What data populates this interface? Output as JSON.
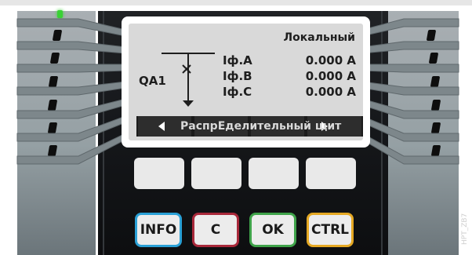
{
  "device": {
    "display": {
      "mode_label": "Локальный",
      "feeder_label": "QA1",
      "measurements": [
        {
          "name": "Iф.A",
          "value": "0.000 A"
        },
        {
          "name": "Iф.B",
          "value": "0.000 A"
        },
        {
          "name": "Iф.C",
          "value": "0.000 A"
        }
      ],
      "nav_title": "РаспрЕделительный щит"
    },
    "function_keys": [
      {
        "label": "INFO",
        "color": "#2aa0d6"
      },
      {
        "label": "C",
        "color": "#a8283a"
      },
      {
        "label": "OK",
        "color": "#3fa34a"
      },
      {
        "label": "CTRL",
        "color": "#e5a823"
      }
    ],
    "side_label": "HPT_ZB7",
    "led_colors": {
      "active": "#39d135",
      "slot": "#0e0e0e"
    }
  }
}
